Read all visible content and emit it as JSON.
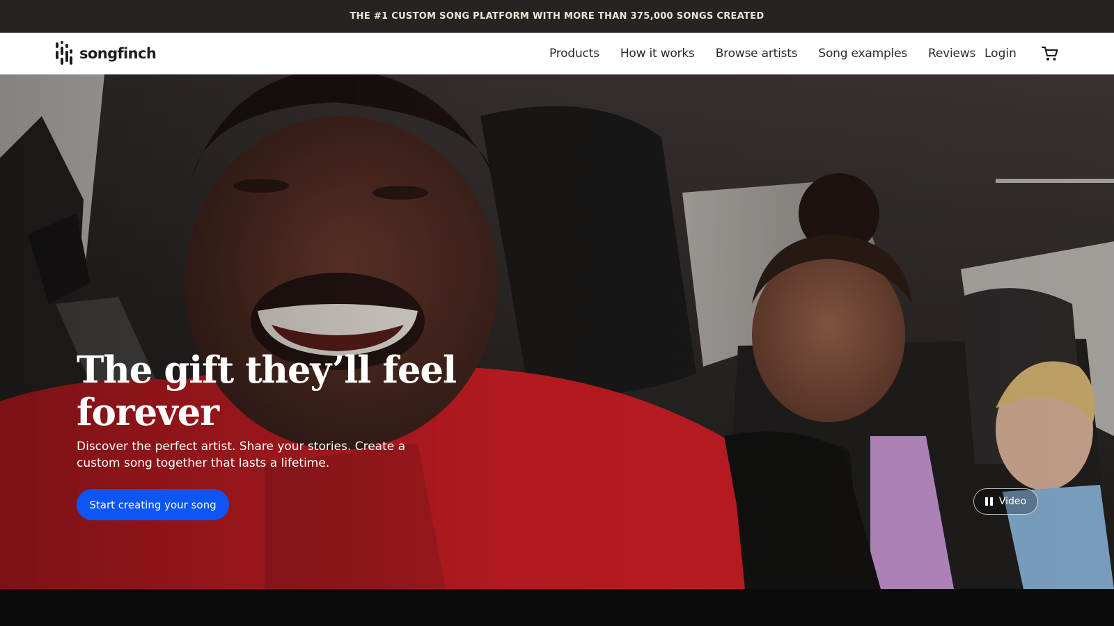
{
  "announcement": {
    "text": "THE #1 CUSTOM SONG PLATFORM WITH MORE THAN 375,000 SONGS CREATED"
  },
  "header": {
    "logo_text": "songfinch",
    "nav": [
      "Products",
      "How it works",
      "Browse artists",
      "Song examples",
      "Reviews"
    ],
    "login_label": "Login",
    "cart_icon": "cart-icon"
  },
  "hero": {
    "headline": "The gift they’ll feel forever",
    "subtext": "Discover the perfect artist. Share your stories. Create a custom song together that lasts a lifetime.",
    "cta_label": "Start creating your song",
    "video_toggle_label": "Video",
    "video_toggle_icon": "pause-icon",
    "background": "photo of a smiling man in a red shirt driving a car with two children in the back seat"
  },
  "colors": {
    "announcement_bg": "#262420",
    "cta_bg": "#0b56f5",
    "nav_bg": "#ffffff",
    "page_bg": "#0b0b0b"
  }
}
